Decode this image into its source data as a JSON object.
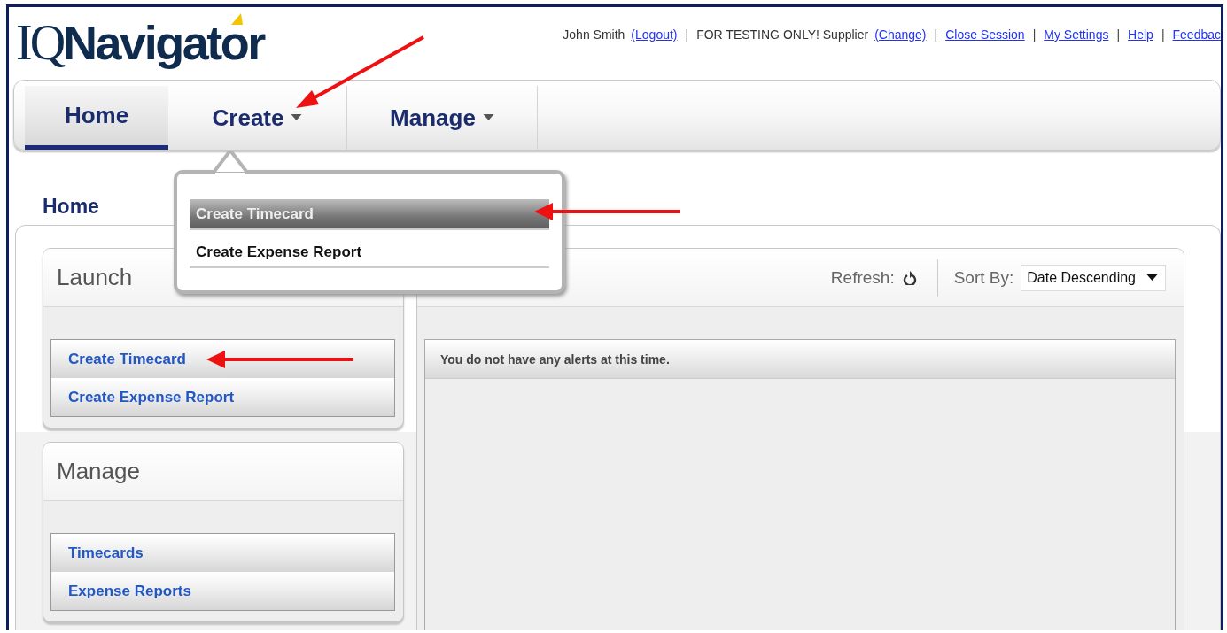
{
  "logo": {
    "prefix": "IQ",
    "name": "Navigator"
  },
  "top_links": [
    {
      "kind": "text",
      "text": "John Smith"
    },
    {
      "kind": "link",
      "text": "(Logout)"
    },
    {
      "kind": "separator",
      "text": "|"
    },
    {
      "kind": "text",
      "text": "FOR TESTING ONLY! Supplier"
    },
    {
      "kind": "link",
      "text": "(Change)"
    },
    {
      "kind": "separator",
      "text": "|"
    },
    {
      "kind": "link",
      "text": "Close Session"
    },
    {
      "kind": "separator",
      "text": "|"
    },
    {
      "kind": "link",
      "text": "My Settings"
    },
    {
      "kind": "separator",
      "text": "|"
    },
    {
      "kind": "link",
      "text": "Help"
    },
    {
      "kind": "separator",
      "text": "|"
    },
    {
      "kind": "link",
      "text": "Feedbac"
    }
  ],
  "nav_tabs": [
    {
      "label": "Home",
      "selected": true,
      "dropdown": false
    },
    {
      "label": "Create",
      "selected": false,
      "dropdown": true
    },
    {
      "label": "Manage",
      "selected": false,
      "dropdown": true
    }
  ],
  "create_menu": {
    "items": [
      {
        "label": "Create Timecard",
        "selected": true
      },
      {
        "label": "Create Expense Report",
        "selected": false
      }
    ]
  },
  "page_title": "Home",
  "cards": [
    {
      "title": "Launch",
      "items": [
        "Create Timecard",
        "Create Expense Report"
      ]
    },
    {
      "title": "Manage",
      "items": [
        "Timecards",
        "Expense Reports"
      ]
    }
  ],
  "alerts": {
    "refresh_label": "Refresh:",
    "sort_label": "Sort By:",
    "sort_value": "Date Descending",
    "message": "You do not have any alerts at this time."
  }
}
